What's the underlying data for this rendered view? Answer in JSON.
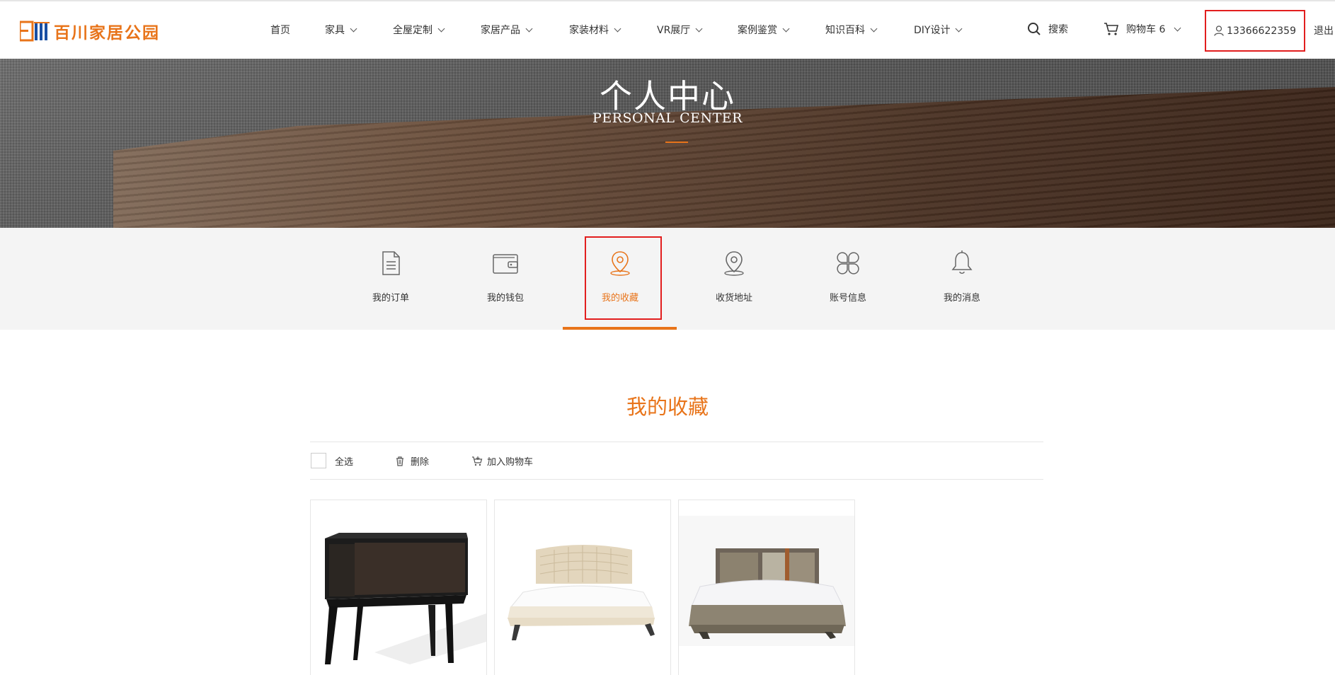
{
  "header": {
    "logo_text": "百川家居公园",
    "nav": [
      {
        "label": "首页",
        "has_menu": false
      },
      {
        "label": "家具",
        "has_menu": true
      },
      {
        "label": "全屋定制",
        "has_menu": true
      },
      {
        "label": "家居产品",
        "has_menu": true
      },
      {
        "label": "家装材料",
        "has_menu": true
      },
      {
        "label": "VR展厅",
        "has_menu": true
      },
      {
        "label": "案例鉴赏",
        "has_menu": true
      },
      {
        "label": "知识百科",
        "has_menu": true
      },
      {
        "label": "DIY设计",
        "has_menu": true
      }
    ],
    "search_label": "搜索",
    "cart_label": "购物车 6",
    "user_phone": "13366622359",
    "logout_label": "退出"
  },
  "banner": {
    "title": "个人中心",
    "subtitle": "PERSONAL CENTER"
  },
  "tabs": [
    {
      "label": "我的订单",
      "icon": "order-document-icon",
      "active": false
    },
    {
      "label": "我的钱包",
      "icon": "wallet-icon",
      "active": false
    },
    {
      "label": "我的收藏",
      "icon": "location-pin-icon",
      "active": true
    },
    {
      "label": "收货地址",
      "icon": "location-pin-icon",
      "active": false
    },
    {
      "label": "账号信息",
      "icon": "clover-grid-icon",
      "active": false
    },
    {
      "label": "我的消息",
      "icon": "bell-icon",
      "active": false
    }
  ],
  "section": {
    "title": "我的收藏"
  },
  "toolbar": {
    "select_all_label": "全选",
    "delete_label": "删除",
    "add_to_cart_label": "加入购物车"
  },
  "favorites": [
    {
      "product": "dark-nightstand"
    },
    {
      "product": "beige-tufted-bed"
    },
    {
      "product": "grey-upholstered-bed"
    }
  ],
  "colors": {
    "accent": "#e8741a",
    "highlight_box": "#e21e1e",
    "tab_bar_bg": "#f4f4f4"
  }
}
